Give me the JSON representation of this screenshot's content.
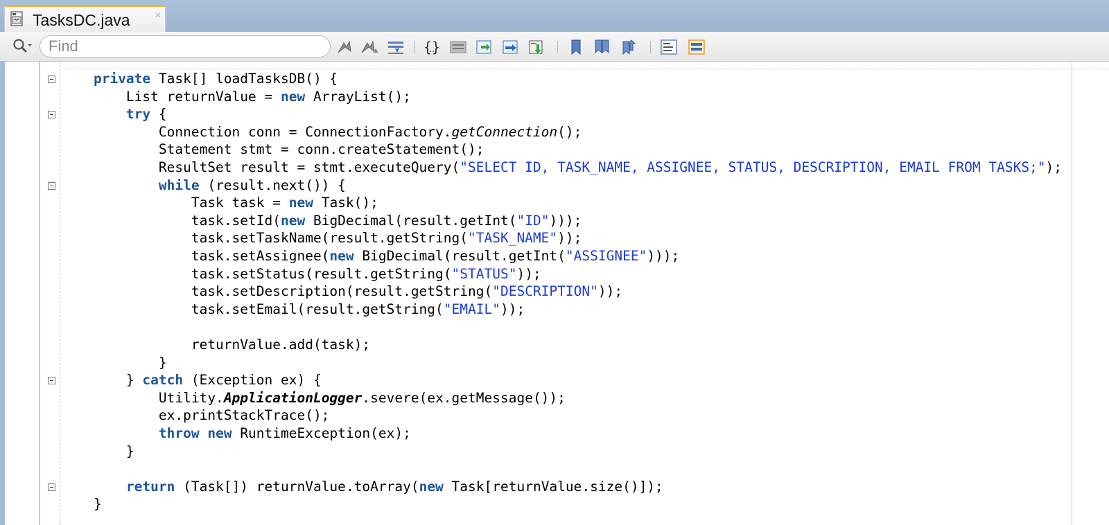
{
  "tab": {
    "title": "TasksDC.java",
    "close_glyph": "×",
    "icon": "java-file-icon"
  },
  "toolbar": {
    "search_icon": "search-options-icon",
    "find_placeholder": "Find",
    "buttons": [
      {
        "name": "prev-occurrence-icon"
      },
      {
        "name": "next-occurrence-icon"
      },
      {
        "name": "toggle-highlight-icon"
      },
      {
        "name": "braces-icon"
      },
      {
        "name": "shift-left-icon"
      },
      {
        "name": "shift-right-icon"
      },
      {
        "name": "move-up-icon"
      },
      {
        "name": "move-down-icon"
      },
      {
        "name": "toggle-bookmark-icon"
      },
      {
        "name": "prev-bookmark-icon"
      },
      {
        "name": "next-bookmark-icon"
      },
      {
        "name": "comment-icon"
      },
      {
        "name": "uncomment-icon"
      }
    ]
  },
  "colors": {
    "keyword": "#1f5599",
    "string": "#1d3ccf",
    "tab_accent": "#f3b23e",
    "window_bg": "#a3bbd6"
  },
  "code": {
    "lines": [
      {
        "fold": true,
        "tokens": [
          [
            "    ",
            "pl"
          ],
          [
            "private",
            "kw"
          ],
          [
            " Task[] loadTasksDB() {",
            "pl"
          ]
        ]
      },
      {
        "fold": false,
        "tokens": [
          [
            "        List returnValue = ",
            "pl"
          ],
          [
            "new",
            "kw"
          ],
          [
            " ArrayList();",
            "pl"
          ]
        ]
      },
      {
        "fold": true,
        "tokens": [
          [
            "        ",
            "pl"
          ],
          [
            "try",
            "kw"
          ],
          [
            " {",
            "pl"
          ]
        ]
      },
      {
        "fold": false,
        "tokens": [
          [
            "            Connection conn = ConnectionFactory.",
            "pl"
          ],
          [
            "getConnection",
            "it"
          ],
          [
            "();",
            "pl"
          ]
        ]
      },
      {
        "fold": false,
        "tokens": [
          [
            "            Statement stmt = conn.createStatement();",
            "pl"
          ]
        ]
      },
      {
        "fold": false,
        "tokens": [
          [
            "            ResultSet result = stmt.executeQuery(",
            "pl"
          ],
          [
            "\"SELECT ID, TASK_NAME, ASSIGNEE, STATUS, DESCRIPTION, EMAIL FROM TASKS;\"",
            "str"
          ],
          [
            ");",
            "pl"
          ]
        ]
      },
      {
        "fold": true,
        "tokens": [
          [
            "            ",
            "pl"
          ],
          [
            "while",
            "kw"
          ],
          [
            " (result.next()) {",
            "pl"
          ]
        ]
      },
      {
        "fold": false,
        "tokens": [
          [
            "                Task task = ",
            "pl"
          ],
          [
            "new",
            "kw"
          ],
          [
            " Task();",
            "pl"
          ]
        ]
      },
      {
        "fold": false,
        "tokens": [
          [
            "                task.setId(",
            "pl"
          ],
          [
            "new",
            "kw"
          ],
          [
            " BigDecimal(result.getInt(",
            "pl"
          ],
          [
            "\"ID\"",
            "str"
          ],
          [
            ")));",
            "pl"
          ]
        ]
      },
      {
        "fold": false,
        "tokens": [
          [
            "                task.setTaskName(result.getString(",
            "pl"
          ],
          [
            "\"TASK_NAME\"",
            "str"
          ],
          [
            "));",
            "pl"
          ]
        ]
      },
      {
        "fold": false,
        "tokens": [
          [
            "                task.setAssignee(",
            "pl"
          ],
          [
            "new",
            "kw"
          ],
          [
            " BigDecimal(result.getInt(",
            "pl"
          ],
          [
            "\"ASSIGNEE\"",
            "str"
          ],
          [
            ")));",
            "pl"
          ]
        ]
      },
      {
        "fold": false,
        "tokens": [
          [
            "                task.setStatus(result.getString(",
            "pl"
          ],
          [
            "\"STATUS\"",
            "str"
          ],
          [
            "));",
            "pl"
          ]
        ]
      },
      {
        "fold": false,
        "tokens": [
          [
            "                task.setDescription(result.getString(",
            "pl"
          ],
          [
            "\"DESCRIPTION\"",
            "str"
          ],
          [
            "));",
            "pl"
          ]
        ]
      },
      {
        "fold": false,
        "tokens": [
          [
            "                task.setEmail(result.getString(",
            "pl"
          ],
          [
            "\"EMAIL\"",
            "str"
          ],
          [
            "));",
            "pl"
          ]
        ]
      },
      {
        "fold": false,
        "tokens": [
          [
            "",
            "pl"
          ]
        ]
      },
      {
        "fold": false,
        "tokens": [
          [
            "                returnValue.add(task);",
            "pl"
          ]
        ]
      },
      {
        "fold": false,
        "tokens": [
          [
            "            }",
            "pl"
          ]
        ]
      },
      {
        "fold": true,
        "tokens": [
          [
            "        } ",
            "pl"
          ],
          [
            "catch",
            "kw"
          ],
          [
            " (Exception ex) {",
            "pl"
          ]
        ]
      },
      {
        "fold": false,
        "tokens": [
          [
            "            Utility.",
            "pl"
          ],
          [
            "ApplicationLogger",
            "bi"
          ],
          [
            ".severe(ex.getMessage());",
            "pl"
          ]
        ]
      },
      {
        "fold": false,
        "tokens": [
          [
            "            ex.printStackTrace();",
            "pl"
          ]
        ]
      },
      {
        "fold": false,
        "tokens": [
          [
            "            ",
            "pl"
          ],
          [
            "throw",
            "kw"
          ],
          [
            " ",
            "pl"
          ],
          [
            "new",
            "kw"
          ],
          [
            " RuntimeException(ex);",
            "pl"
          ]
        ]
      },
      {
        "fold": false,
        "tokens": [
          [
            "        }",
            "pl"
          ]
        ]
      },
      {
        "fold": false,
        "tokens": [
          [
            "",
            "pl"
          ]
        ]
      },
      {
        "fold": true,
        "tokens": [
          [
            "        ",
            "pl"
          ],
          [
            "return",
            "kw"
          ],
          [
            " (Task[]) returnValue.toArray(",
            "pl"
          ],
          [
            "new",
            "kw"
          ],
          [
            " Task[returnValue.size()]);",
            "pl"
          ]
        ]
      },
      {
        "fold": false,
        "tokens": [
          [
            "    }",
            "pl"
          ]
        ]
      }
    ]
  }
}
